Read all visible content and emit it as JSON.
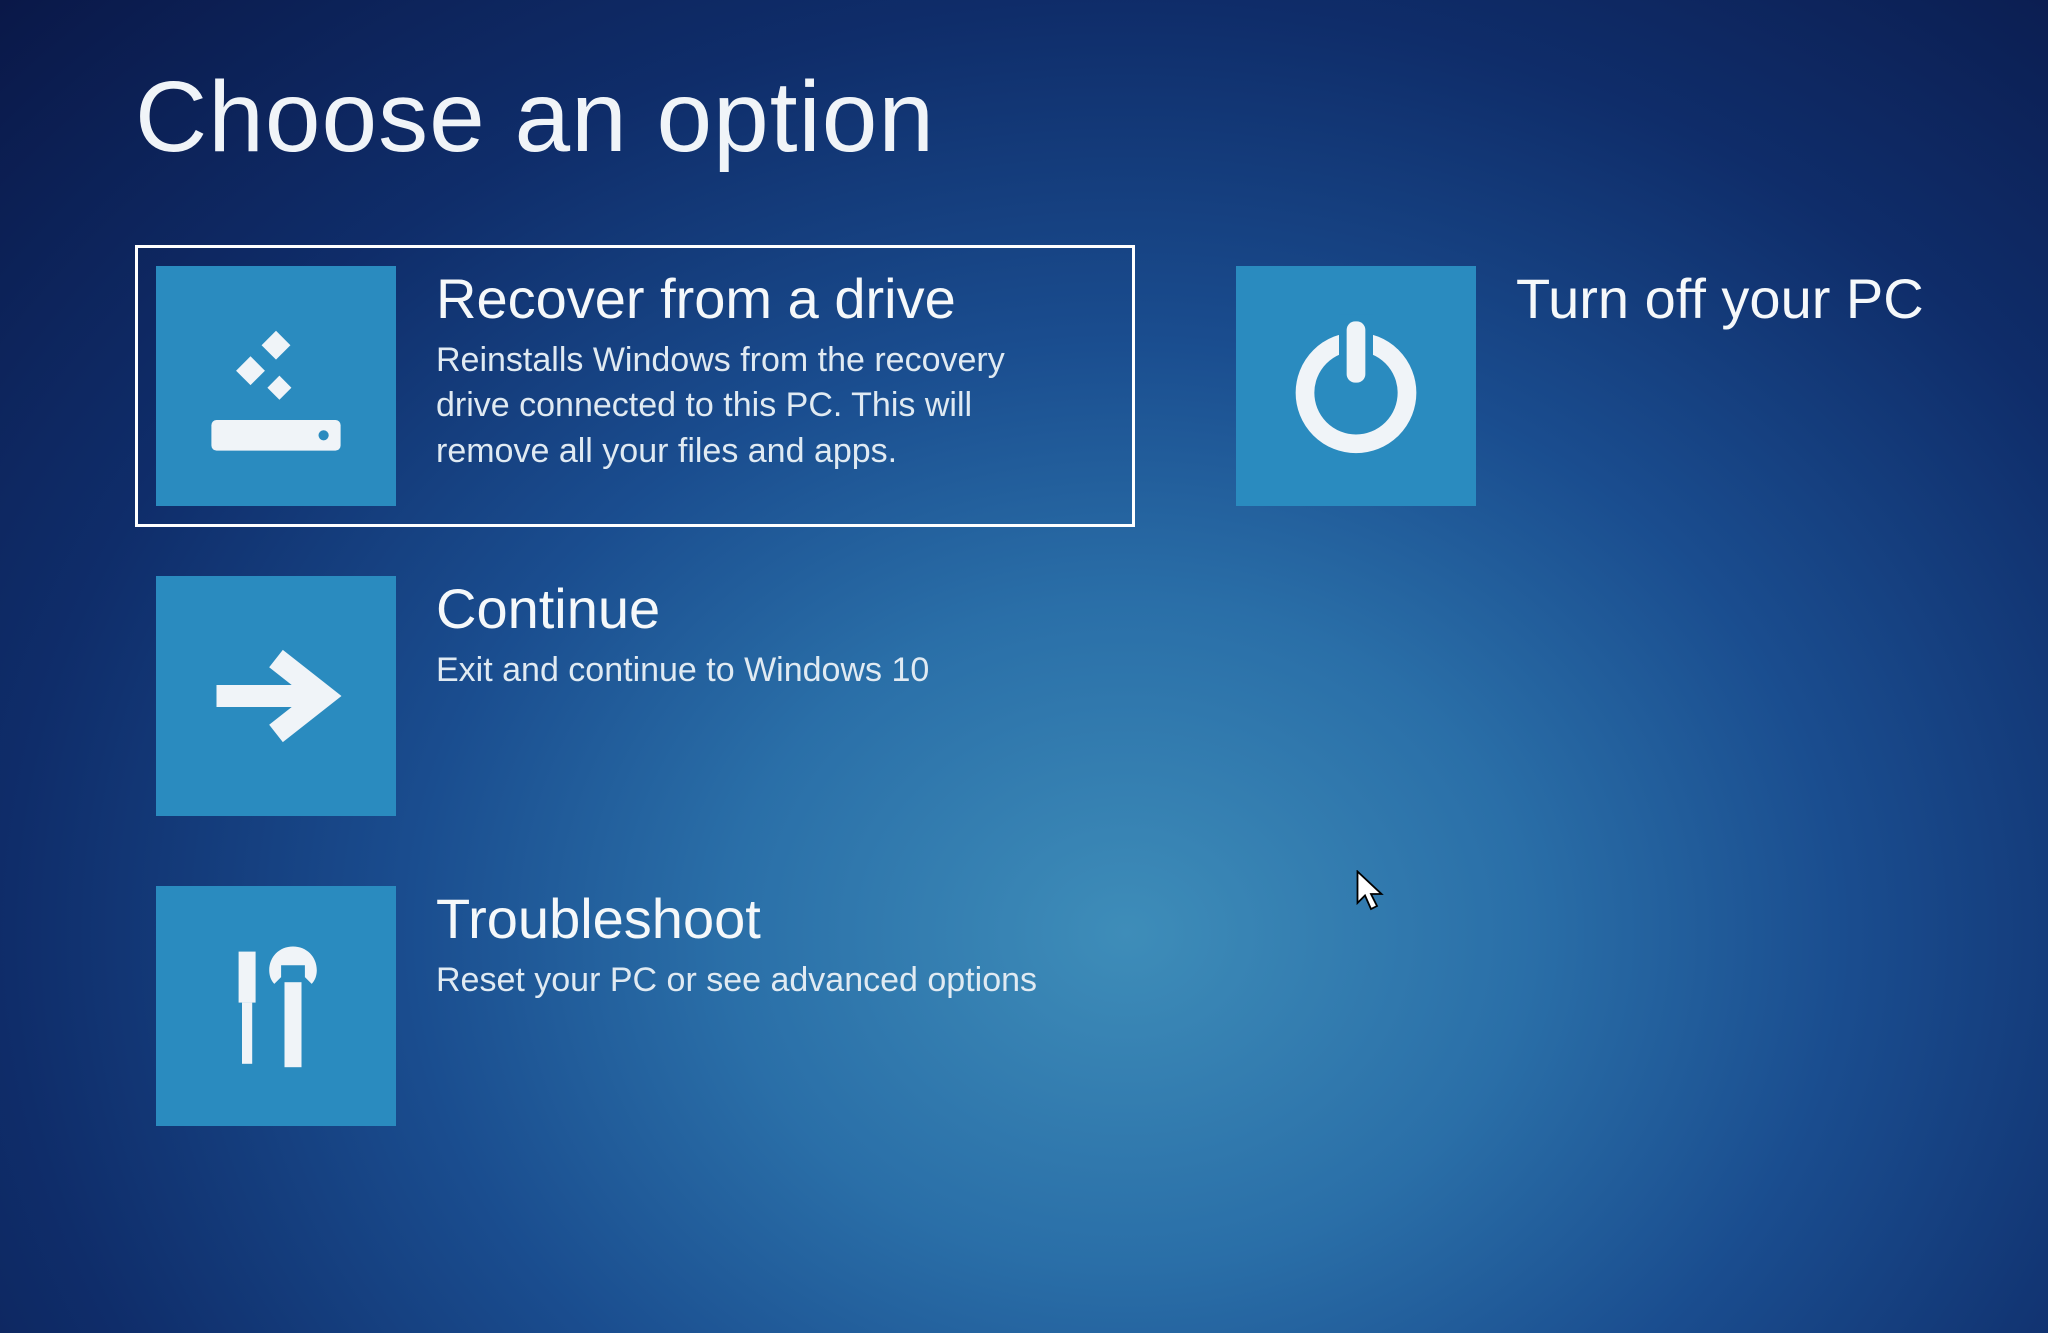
{
  "title": "Choose an option",
  "options": {
    "recover": {
      "title": "Recover from a drive",
      "description": "Reinstalls Windows from the recovery drive connected to this PC. This will remove all your files and apps."
    },
    "continue": {
      "title": "Continue",
      "description": "Exit and continue to Windows 10"
    },
    "troubleshoot": {
      "title": "Troubleshoot",
      "description": "Reset your PC or see advanced options"
    },
    "turnoff": {
      "title": "Turn off your PC",
      "description": ""
    }
  }
}
